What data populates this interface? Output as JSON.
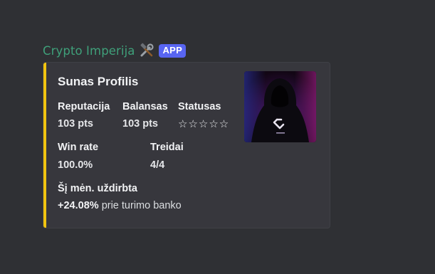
{
  "message": {
    "author": "Crypto Imperija",
    "badge": "APP",
    "author_icon": "hammer-wrench-icon"
  },
  "embed": {
    "accent_color": "#f1c40f",
    "title": "Sunas Profilis",
    "thumbnail_icon": "hooded-figure-crypto-logo",
    "fields": [
      {
        "name": "Reputacija",
        "value": "103 pts"
      },
      {
        "name": "Balansas",
        "value": "103 pts"
      },
      {
        "name": "Statusas",
        "value": "☆☆☆☆☆"
      },
      {
        "name": "Win rate",
        "value": "100.0%"
      },
      {
        "name": "Treidai",
        "value": "4/4"
      }
    ],
    "earned": {
      "name": "Šį mėn. uždirbta",
      "value": "+24.08%",
      "suffix": "prie turimo banko"
    }
  }
}
